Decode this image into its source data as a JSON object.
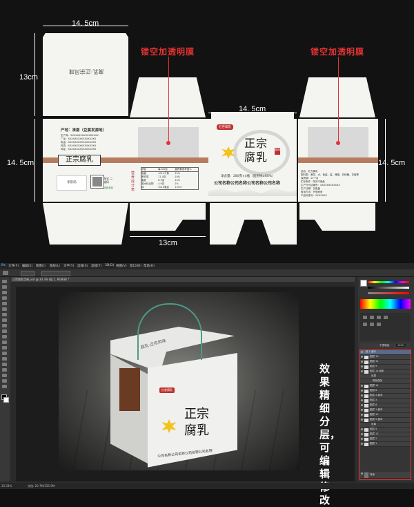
{
  "dieline": {
    "dimensions": {
      "top_width": "14. 5cm",
      "left_height_top": "13cm",
      "left_height_mid": "14. 5cm",
      "right_height_mid": "14. 5cm",
      "mid_width": "14. 5cm",
      "bottom_width": "13cm"
    },
    "annotations": {
      "left_note": "镂空加透明膜",
      "right_note": "镂空加透明膜"
    },
    "top_panel_text": "腐乳·正宗风味",
    "side_panel": {
      "origin_label": "产地：淮南（豆腐发源地）",
      "info_lines": [
        "生产商：XXXXXXXXXXXXXXXXX",
        "厂址：XXXXXXXXXXXXXXXXX",
        "电话：XXXXXXXXXXXXXXXXX",
        "传真：XXXXXXXXXXXXXXXXX",
        "网址：XXXXXXXXXXXXXXXXX"
      ],
      "brand_box": "正宗腐乳",
      "barcode_label": "条形码",
      "qr_label": "淘宝 二维码",
      "safety_label": "绿色食品"
    },
    "nutrition_panel": {
      "title": "营养成分表",
      "header": [
        "项目",
        "每100克",
        "营养素参考值%"
      ],
      "rows": [
        [
          "能量",
          "1011千焦",
          "12%"
        ],
        [
          "蛋白质",
          "11.0克",
          "18%"
        ],
        [
          "脂肪",
          "8.3克",
          "14%"
        ],
        [
          "碳水化合物",
          "4.9克",
          "2%"
        ],
        [
          "钠",
          "3010毫克",
          "151%"
        ]
      ]
    },
    "front_panel": {
      "logo": "红杏腐乳",
      "title_line1": "正宗",
      "title_line2": "腐乳",
      "seal": "淮南",
      "net_content": "净含量：280克×4瓶（固形物≥60%）",
      "company": "公司名称公司名称公司名称公司名称"
    },
    "right_info_panel": {
      "lines": [
        "品名：红方腐乳",
        "配料表：黄豆、水、食盐、盐、辣椒、白砂糖、花椒等",
        "保质期：12个月",
        "贮存条件：阴凉干燥处",
        "生产许可证编号：XXXXXXXXXXXX",
        "生产日期：见瓶盖",
        "食用方法：开瓶即食",
        "产品标准号：XXXXXXX"
      ]
    }
  },
  "photoshop": {
    "menu": [
      "文件(F)",
      "编辑(E)",
      "图像(I)",
      "图层(L)",
      "文字(Y)",
      "选择(S)",
      "滤镜(T)",
      "3D(D)",
      "视图(V)",
      "窗口(W)",
      "帮助(H)"
    ],
    "doc_tab": "正宗腐乳包装.psd @ 33.3% (组 1, RGB/8) *",
    "status": "33.33%",
    "status_doc": "文档: 20.7M/155.9M",
    "side_caption": "效果精细分层，可编辑修改",
    "layer_panel": {
      "opacity_label": "不透明度:",
      "opacity_value": "100%",
      "fill_label": "填充:",
      "fill_value": "100%",
      "group_name": "组 1 副本",
      "layers": [
        "图层 10",
        "图层 11",
        "图层 9",
        "图层 14 副本",
        "效果",
        "颜色叠加",
        "图层 14",
        "图层 8",
        "图层 4 副本",
        "图层 3",
        "图层 6",
        "图层 1 副本",
        "图层 12",
        "图层 5 副本",
        "效果",
        "图层 5",
        "图层 13",
        "图层 2",
        "图层 1"
      ],
      "bottom_layer": "背景"
    },
    "colors": {
      "accent": "#e43232",
      "panel_bg": "#353535",
      "canvas_bg": "#1c1c1c"
    }
  }
}
